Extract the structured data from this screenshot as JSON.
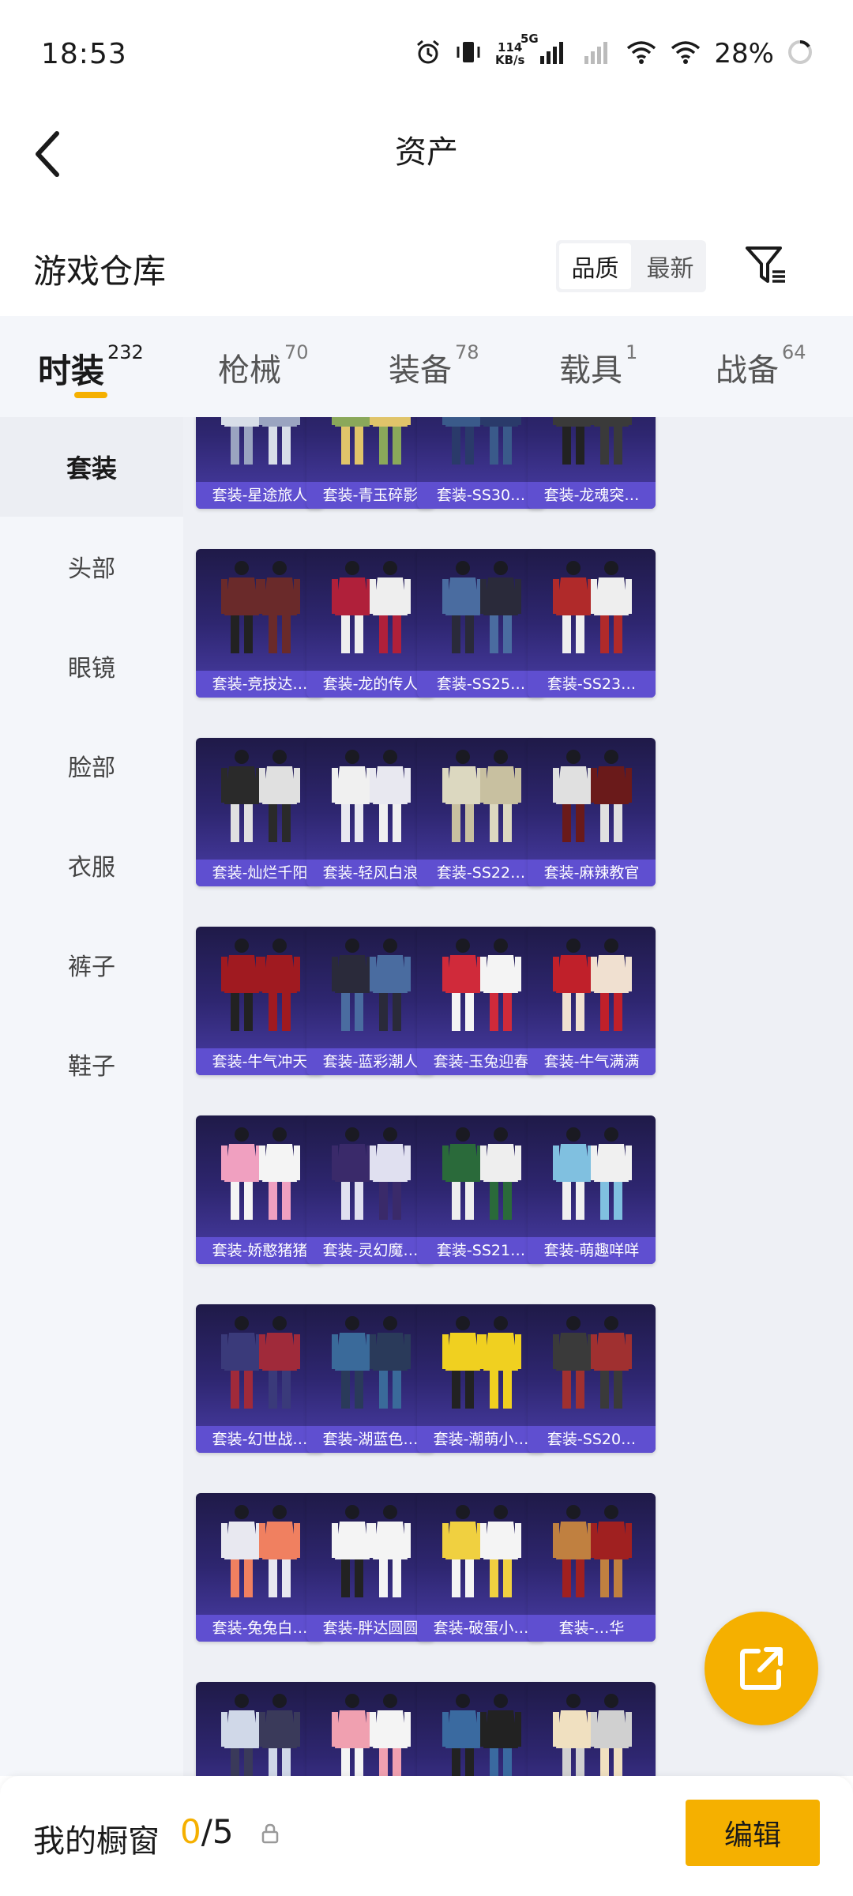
{
  "status_bar": {
    "time": "18:53",
    "net_speed_value": "114",
    "net_speed_unit": "KB/s",
    "network_type": "5G",
    "battery": "28%"
  },
  "header": {
    "title": "资产"
  },
  "warehouse": {
    "title": "游戏仓库",
    "sort_options": [
      "品质",
      "最新"
    ],
    "active_sort": "品质"
  },
  "tabs": [
    {
      "label": "时装",
      "count": "232"
    },
    {
      "label": "枪械",
      "count": "70"
    },
    {
      "label": "装备",
      "count": "78"
    },
    {
      "label": "载具",
      "count": "1"
    },
    {
      "label": "战备",
      "count": "64"
    }
  ],
  "sidebar": {
    "items": [
      "套装",
      "头部",
      "眼镜",
      "脸部",
      "衣服",
      "裤子",
      "鞋子"
    ],
    "active": "套装"
  },
  "items": [
    "套装-星途旅人",
    "套装-青玉碎影",
    "套装-SS30…",
    "套装-龙魂突…",
    "套装-竞技达…",
    "套装-龙的传人",
    "套装-SS25…",
    "套装-SS23…",
    "套装-灿烂千阳",
    "套装-轻风白浪",
    "套装-SS22…",
    "套装-麻辣教官",
    "套装-牛气冲天",
    "套装-蓝彩潮人",
    "套装-玉兔迎春",
    "套装-牛气满满",
    "套装-娇憨猪猪",
    "套装-灵幻魔…",
    "套装-SS21…",
    "套装-萌趣咩咩",
    "套装-幻世战…",
    "套装-湖蓝色…",
    "套装-潮萌小…",
    "套装-SS20…",
    "套装-兔兔白…",
    "套装-胖达圆圆",
    "套装-破蛋小…",
    "套装-…华",
    "",
    "",
    "",
    ""
  ],
  "bottom": {
    "showcase_label": "我的橱窗",
    "showcase_current": "0",
    "showcase_total": "/5",
    "edit_label": "编辑"
  },
  "colors": {
    "accent": "#f5b000",
    "card_label_bg": "#5f4fd0",
    "card_bg_top": "#1f1a48",
    "card_bg_bottom": "#4a3ea8"
  }
}
